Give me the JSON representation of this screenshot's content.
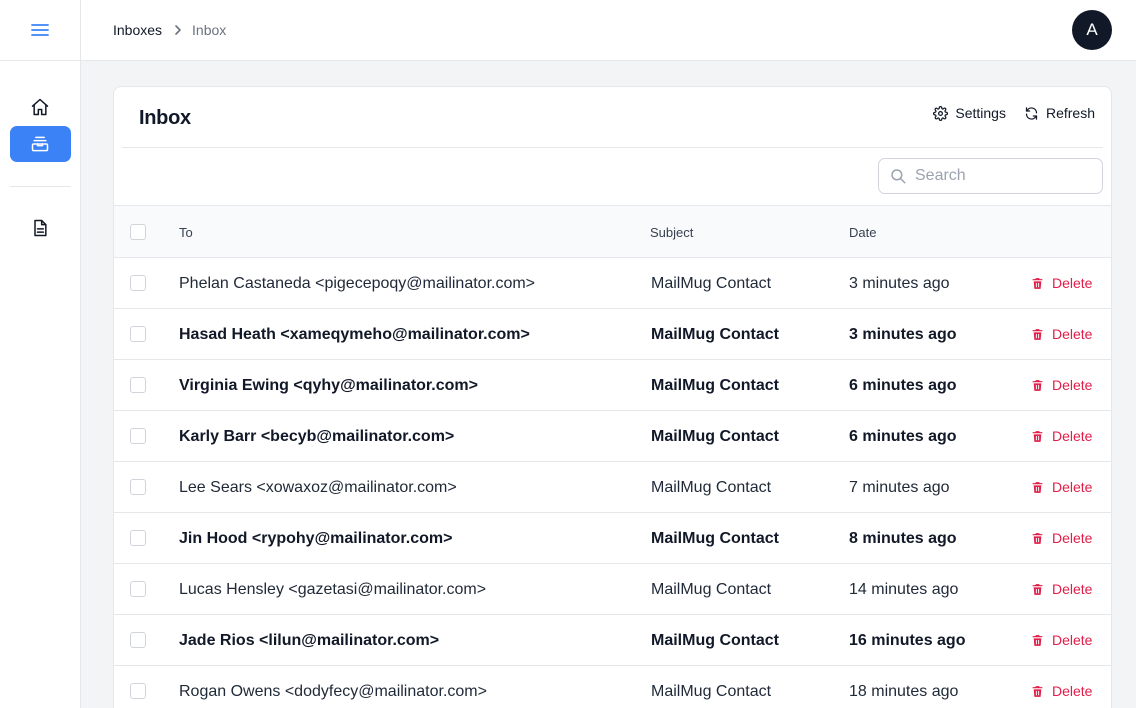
{
  "sidebar": {
    "menu_icon": "hamburger-icon",
    "items": [
      {
        "name": "home",
        "icon": "home-icon",
        "active": false
      },
      {
        "name": "inboxes",
        "icon": "inbox-tray-icon",
        "active": true
      },
      {
        "name": "docs",
        "icon": "document-icon",
        "active": false
      }
    ]
  },
  "header": {
    "breadcrumb": [
      {
        "label": "Inboxes"
      },
      {
        "label": "Inbox"
      }
    ],
    "avatar_initial": "A"
  },
  "inbox": {
    "title": "Inbox",
    "settings_label": "Settings",
    "refresh_label": "Refresh",
    "search_placeholder": "Search",
    "columns": {
      "to": "To",
      "subject": "Subject",
      "date": "Date"
    },
    "delete_label": "Delete",
    "rows": [
      {
        "to": "Phelan Castaneda <pigecepoqy@mailinator.com>",
        "subject": "MailMug Contact",
        "date": "3 minutes ago",
        "unread": false
      },
      {
        "to": "Hasad Heath <xameqymeho@mailinator.com>",
        "subject": "MailMug Contact",
        "date": "3 minutes ago",
        "unread": true
      },
      {
        "to": "Virginia Ewing <qyhy@mailinator.com>",
        "subject": "MailMug Contact",
        "date": "6 minutes ago",
        "unread": true
      },
      {
        "to": "Karly Barr <becyb@mailinator.com>",
        "subject": "MailMug Contact",
        "date": "6 minutes ago",
        "unread": true
      },
      {
        "to": "Lee Sears <xowaxoz@mailinator.com>",
        "subject": "MailMug Contact",
        "date": "7 minutes ago",
        "unread": false
      },
      {
        "to": "Jin Hood <rypohy@mailinator.com>",
        "subject": "MailMug Contact",
        "date": "8 minutes ago",
        "unread": true
      },
      {
        "to": "Lucas Hensley <gazetasi@mailinator.com>",
        "subject": "MailMug Contact",
        "date": "14 minutes ago",
        "unread": false
      },
      {
        "to": "Jade Rios <lilun@mailinator.com>",
        "subject": "MailMug Contact",
        "date": "16 minutes ago",
        "unread": true
      },
      {
        "to": "Rogan Owens <dodyfecy@mailinator.com>",
        "subject": "MailMug Contact",
        "date": "18 minutes ago",
        "unread": false
      }
    ]
  },
  "colors": {
    "accent": "#3b82f6",
    "danger": "#e11d48",
    "avatar_bg": "#111827"
  }
}
